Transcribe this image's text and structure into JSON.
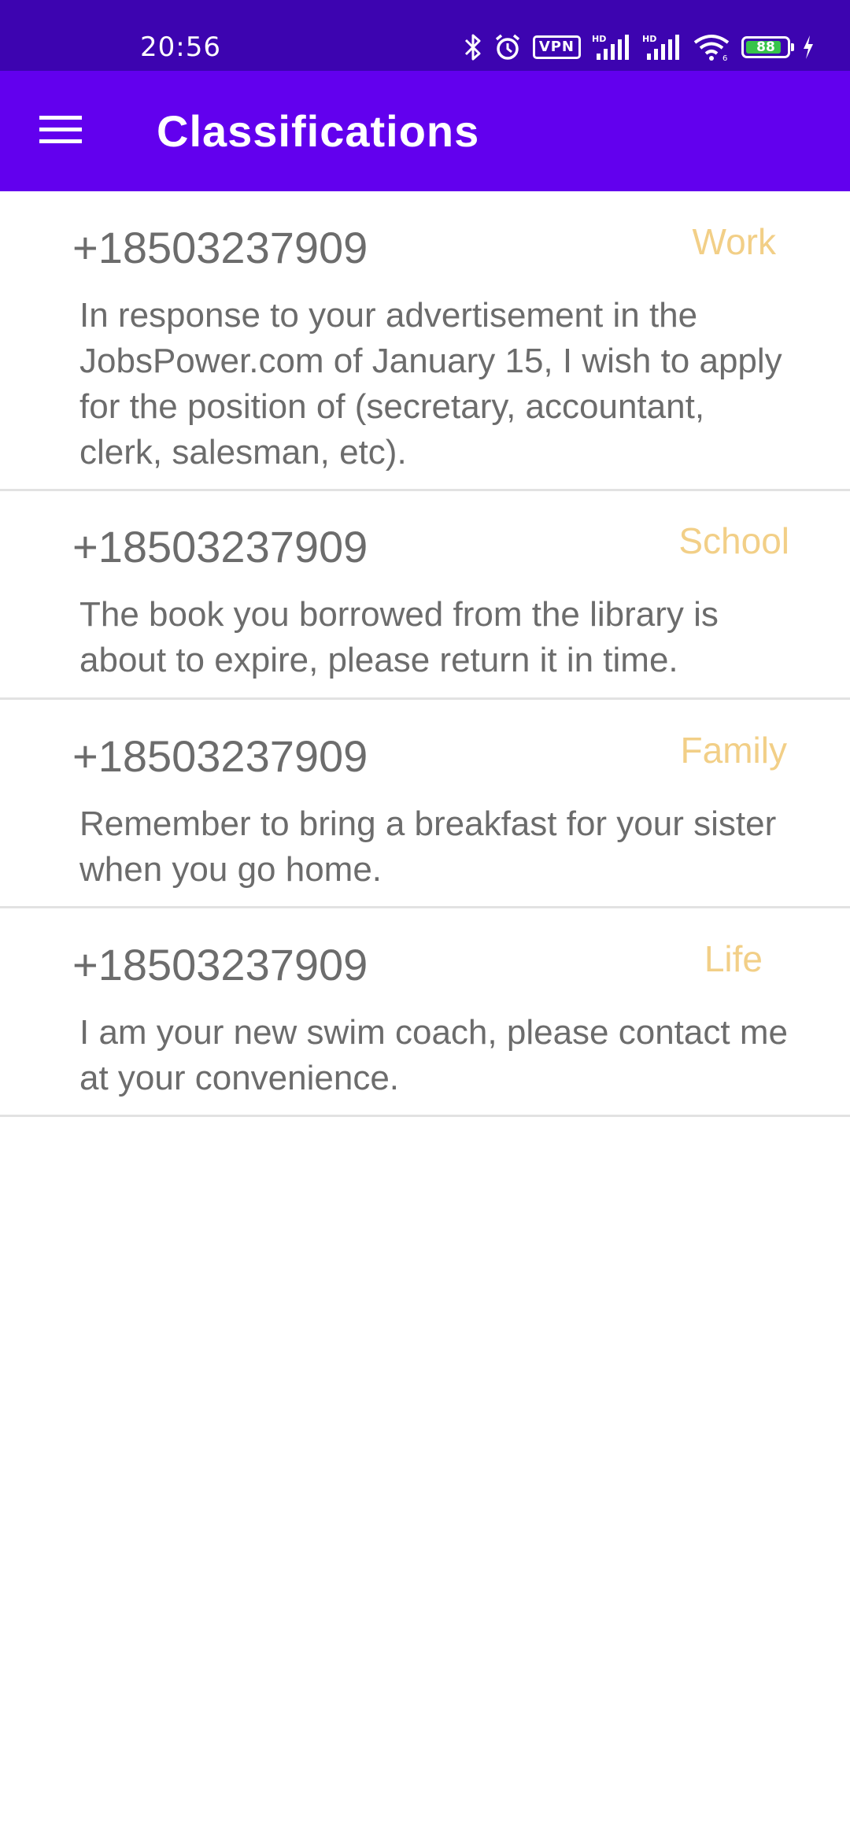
{
  "status_bar": {
    "time": "20:56",
    "vpn_label": "VPN",
    "battery_level": "88",
    "battery_fraction": 0.88,
    "icons": [
      "bluetooth-icon",
      "alarm-icon",
      "vpn-icon",
      "hd-signal-icon",
      "hd-signal-icon",
      "wifi-icon",
      "battery-icon",
      "charging-icon"
    ]
  },
  "app_bar": {
    "title": "Classifications",
    "menu_icon": "hamburger-menu-icon"
  },
  "colors": {
    "status_bar_bg": "#3d04b0",
    "app_bar_bg": "#6200ee",
    "tag_color": "#f2cf87",
    "text_color": "#6c6c6c",
    "divider": "#e2e2e2"
  },
  "messages": [
    {
      "phone": "+18503237909",
      "tag": "Work",
      "body": "In response to your advertisement in the JobsPower.com of January 15, I wish to apply for the position of (secretary, accountant, clerk, salesman, etc)."
    },
    {
      "phone": "+18503237909",
      "tag": "School",
      "body": "The book you borrowed from the library is about to expire, please return it in time."
    },
    {
      "phone": "+18503237909",
      "tag": "Family",
      "body": "Remember to bring a breakfast for your sister when you go home."
    },
    {
      "phone": "+18503237909",
      "tag": "Life",
      "body": "I am your new swim coach, please contact me at your convenience."
    }
  ]
}
